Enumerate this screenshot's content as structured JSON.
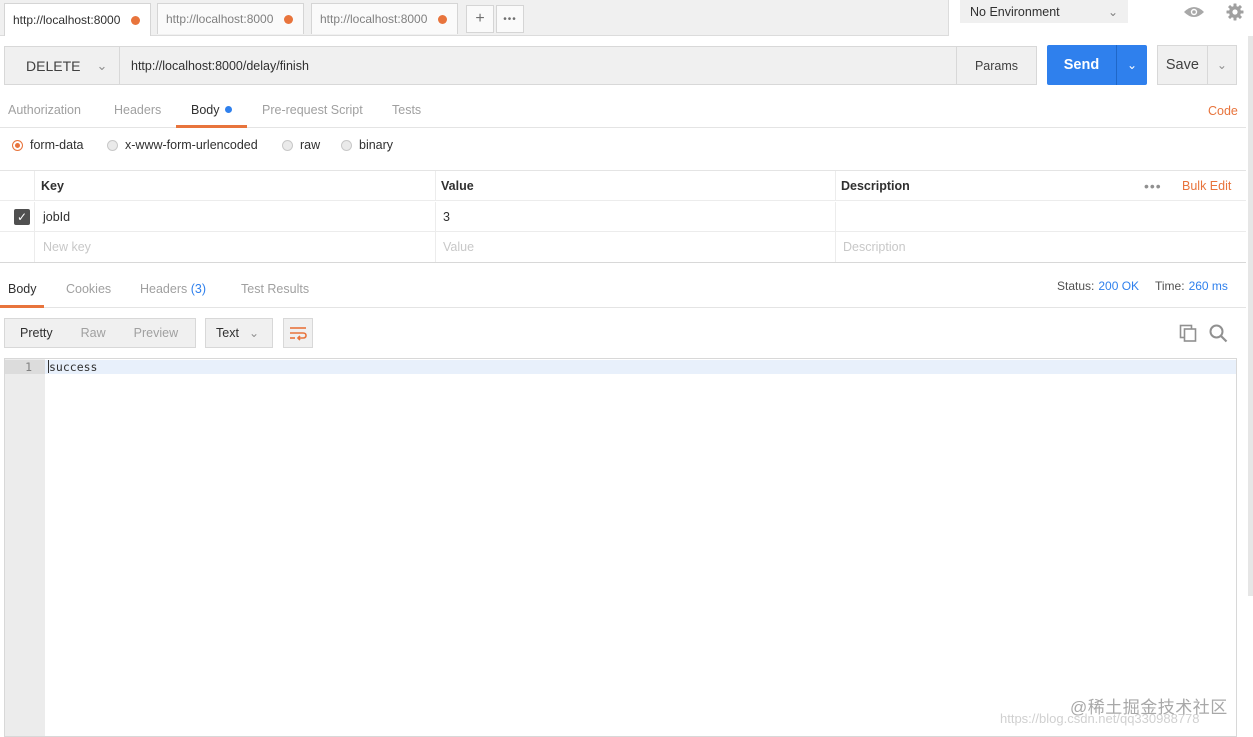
{
  "tabs": [
    {
      "label": "http://localhost:8000",
      "active": true
    },
    {
      "label": "http://localhost:8000",
      "active": false
    },
    {
      "label": "http://localhost:8000",
      "active": false
    }
  ],
  "tab_actions": {
    "add": "+",
    "more": "•••"
  },
  "environment": {
    "selected": "No Environment"
  },
  "request": {
    "method": "DELETE",
    "url": "http://localhost:8000/delay/finish",
    "params_label": "Params",
    "send_label": "Send",
    "save_label": "Save"
  },
  "request_tabs": [
    {
      "label": "Authorization"
    },
    {
      "label": "Headers"
    },
    {
      "label": "Body",
      "active": true
    },
    {
      "label": "Pre-request Script"
    },
    {
      "label": "Tests"
    }
  ],
  "code_link": "Code",
  "body_types": [
    {
      "label": "form-data",
      "checked": true
    },
    {
      "label": "x-www-form-urlencoded",
      "checked": false
    },
    {
      "label": "raw",
      "checked": false
    },
    {
      "label": "binary",
      "checked": false
    }
  ],
  "params_table": {
    "headers": {
      "key": "Key",
      "value": "Value",
      "description": "Description"
    },
    "bulk_edit": "Bulk Edit",
    "rows": [
      {
        "key": "jobId",
        "value": "3",
        "description": "",
        "enabled": true
      }
    ],
    "placeholders": {
      "key": "New key",
      "value": "Value",
      "description": "Description"
    }
  },
  "response": {
    "tabs": [
      {
        "label": "Body",
        "active": true
      },
      {
        "label": "Cookies"
      },
      {
        "label": "Headers",
        "count": "(3)"
      },
      {
        "label": "Test Results"
      }
    ],
    "status_label": "Status:",
    "status_value": "200 OK",
    "time_label": "Time:",
    "time_value": "260 ms",
    "view_modes": [
      "Pretty",
      "Raw",
      "Preview"
    ],
    "format": "Text",
    "body_lines": [
      {
        "number": "1",
        "text": "success"
      }
    ]
  },
  "watermark": {
    "line1": "@稀土掘金技术社区",
    "line2": "https://blog.csdn.net/qq330988778"
  },
  "colors": {
    "accent": "#e8743c",
    "send": "#2f80ed"
  }
}
